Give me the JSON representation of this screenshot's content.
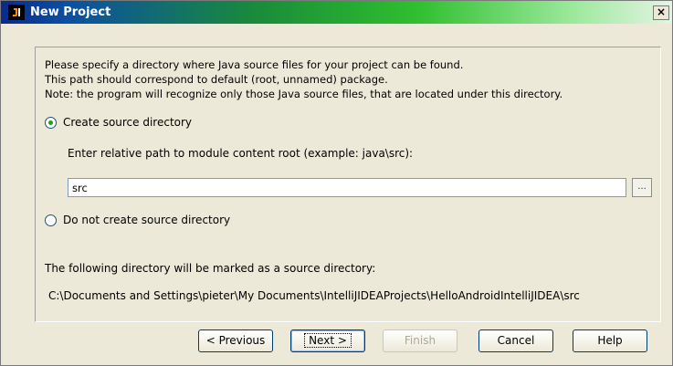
{
  "window": {
    "title": "New Project",
    "close_label": "×"
  },
  "intro": {
    "line1": "Please specify a directory where Java source files for your project can be found.",
    "line2": "This path should correspond to default (root, unnamed) package.",
    "line3": "Note: the program will recognize only those Java source files, that are located under this directory."
  },
  "options": {
    "create": {
      "label": "Create source directory",
      "checked": true
    },
    "do_not_create": {
      "label": "Do not create source directory",
      "checked": false
    }
  },
  "path": {
    "hint": "Enter relative path to module content root  (example: java\\src):",
    "value": "src",
    "browse_label": "..."
  },
  "info": {
    "label": "The following directory will be marked as a source directory:",
    "path": "C:\\Documents and Settings\\pieter\\My Documents\\IntelliJIDEAProjects\\HelloAndroidIntelliJIDEA\\src"
  },
  "buttons": {
    "previous": "< Previous",
    "next": "Next >",
    "finish": "Finish",
    "cancel": "Cancel",
    "help": "Help"
  }
}
